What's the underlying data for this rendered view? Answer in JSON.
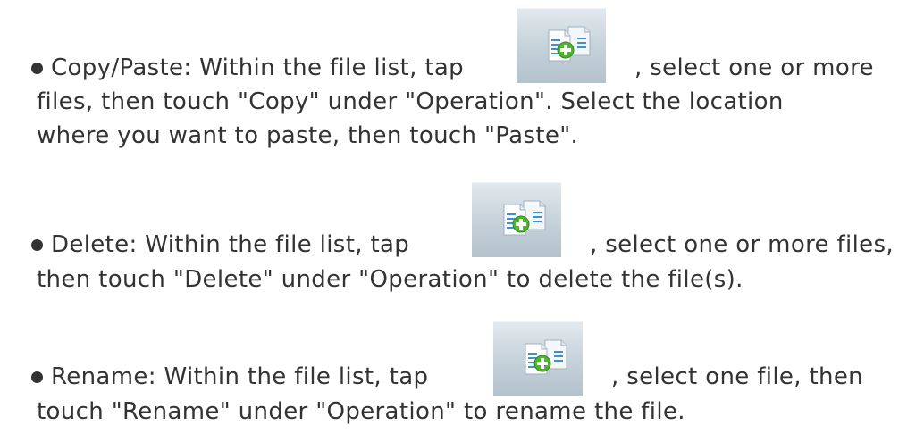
{
  "items": [
    {
      "line1_before": "Copy/Paste: Within the file list, tap",
      "line1_after": ", select one or more",
      "line2": "files, then touch \"Copy\" under \"Operation\". Select the location",
      "line3": "where you want to paste, then touch \"Paste\".",
      "icon": "multi-select-files-icon"
    },
    {
      "line1_before": "Delete: Within the file list, tap",
      "line1_after": ", select one or more files,",
      "line2": "then touch \"Delete\" under \"Operation\" to delete the file(s).",
      "icon": "multi-select-files-icon"
    },
    {
      "line1_before": "Rename: Within the file list, tap",
      "line1_after": ", select one file, then",
      "line2": "touch \"Rename\" under \"Operation\" to rename the file.",
      "icon": "multi-select-files-icon"
    }
  ],
  "colors": {
    "text": "#333333",
    "icon_button_bg": "#c9d4dc",
    "icon_plus": "#5cc43a",
    "icon_doc_lines": "#3d8fd6"
  }
}
